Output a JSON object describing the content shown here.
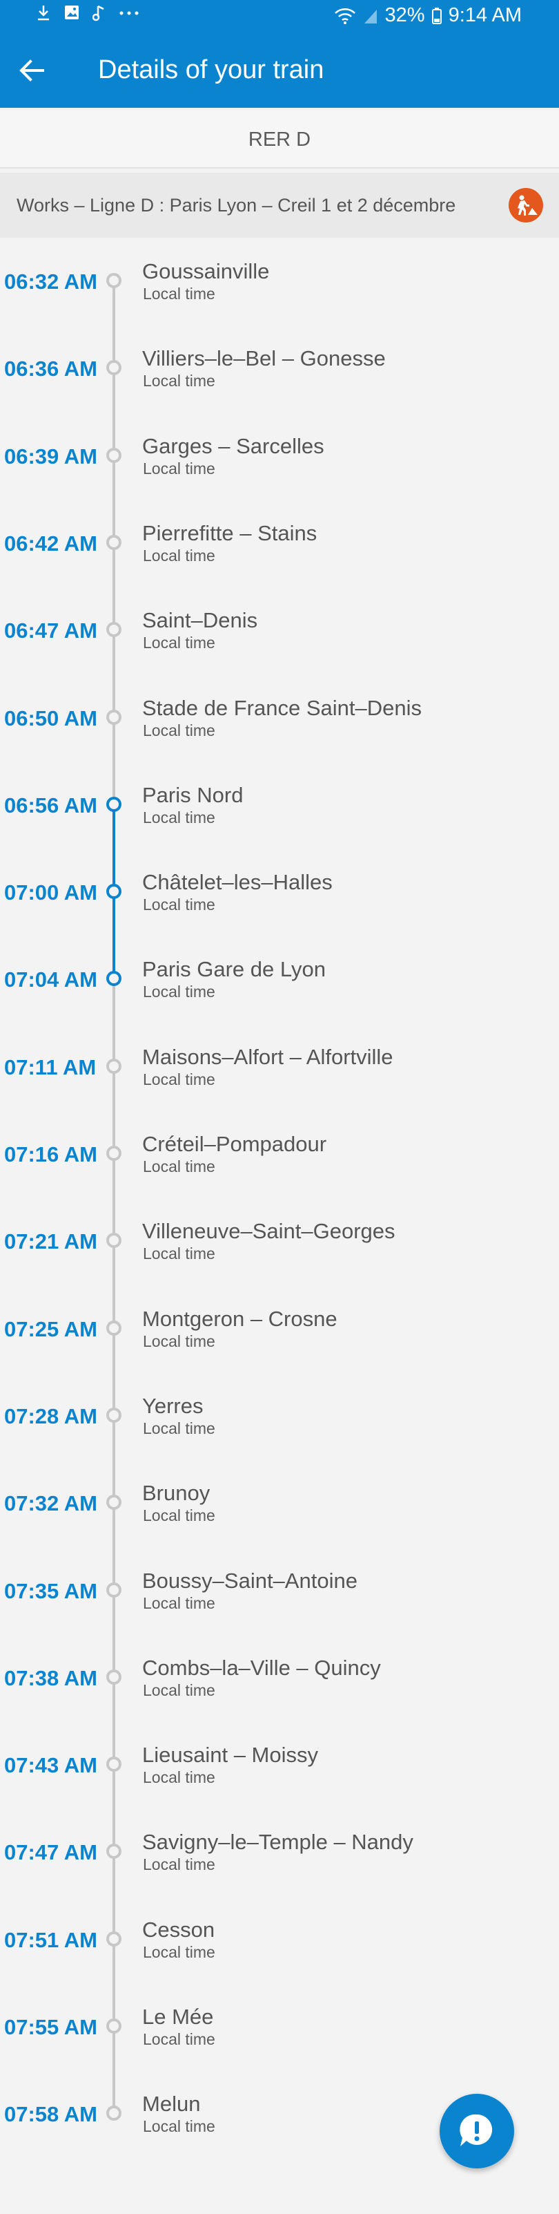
{
  "status_bar": {
    "battery": "32%",
    "time": "9:14 AM",
    "left_icons": [
      "download-icon",
      "image-icon",
      "music-note-icon",
      "more-dots-icon"
    ],
    "right_icons": [
      "wifi-icon",
      "signal-icon",
      "battery-icon"
    ]
  },
  "app_bar": {
    "title": "Details of your train",
    "back_icon": "arrow-back-icon"
  },
  "line": {
    "name": "RER D"
  },
  "alert": {
    "text": "Works – Ligne D : Paris Lyon – Creil 1 et 2 décembre",
    "icon": "roadworks-icon",
    "color": "#e4571d"
  },
  "colors": {
    "primary": "#0b84d0",
    "track_inactive": "#c7c7c7",
    "alert_badge": "#e4571d"
  },
  "stops": [
    {
      "time": "06:32 AM",
      "name": "Goussainville",
      "sub": "Local time",
      "active": false
    },
    {
      "time": "06:36 AM",
      "name": "Villiers–le–Bel – Gonesse",
      "sub": "Local time",
      "active": false
    },
    {
      "time": "06:39 AM",
      "name": "Garges – Sarcelles",
      "sub": "Local time",
      "active": false
    },
    {
      "time": "06:42 AM",
      "name": "Pierrefitte – Stains",
      "sub": "Local time",
      "active": false
    },
    {
      "time": "06:47 AM",
      "name": "Saint–Denis",
      "sub": "Local time",
      "active": false
    },
    {
      "time": "06:50 AM",
      "name": "Stade de France Saint–Denis",
      "sub": "Local time",
      "active": false
    },
    {
      "time": "06:56 AM",
      "name": "Paris Nord",
      "sub": "Local time",
      "active": true
    },
    {
      "time": "07:00 AM",
      "name": "Châtelet–les–Halles",
      "sub": "Local time",
      "active": true
    },
    {
      "time": "07:04 AM",
      "name": "Paris Gare de Lyon",
      "sub": "Local time",
      "active": true
    },
    {
      "time": "07:11 AM",
      "name": "Maisons–Alfort – Alfortville",
      "sub": "Local time",
      "active": false
    },
    {
      "time": "07:16 AM",
      "name": "Créteil–Pompadour",
      "sub": "Local time",
      "active": false
    },
    {
      "time": "07:21 AM",
      "name": "Villeneuve–Saint–Georges",
      "sub": "Local time",
      "active": false
    },
    {
      "time": "07:25 AM",
      "name": "Montgeron – Crosne",
      "sub": "Local time",
      "active": false
    },
    {
      "time": "07:28 AM",
      "name": "Yerres",
      "sub": "Local time",
      "active": false
    },
    {
      "time": "07:32 AM",
      "name": "Brunoy",
      "sub": "Local time",
      "active": false
    },
    {
      "time": "07:35 AM",
      "name": "Boussy–Saint–Antoine",
      "sub": "Local time",
      "active": false
    },
    {
      "time": "07:38 AM",
      "name": "Combs–la–Ville – Quincy",
      "sub": "Local time",
      "active": false
    },
    {
      "time": "07:43 AM",
      "name": "Lieusaint – Moissy",
      "sub": "Local time",
      "active": false
    },
    {
      "time": "07:47 AM",
      "name": "Savigny–le–Temple – Nandy",
      "sub": "Local time",
      "active": false
    },
    {
      "time": "07:51 AM",
      "name": "Cesson",
      "sub": "Local time",
      "active": false
    },
    {
      "time": "07:55 AM",
      "name": "Le Mée",
      "sub": "Local time",
      "active": false
    },
    {
      "time": "07:58 AM",
      "name": "Melun",
      "sub": "Local time",
      "active": false
    }
  ],
  "fab": {
    "icon": "alert-exclamation-icon"
  }
}
